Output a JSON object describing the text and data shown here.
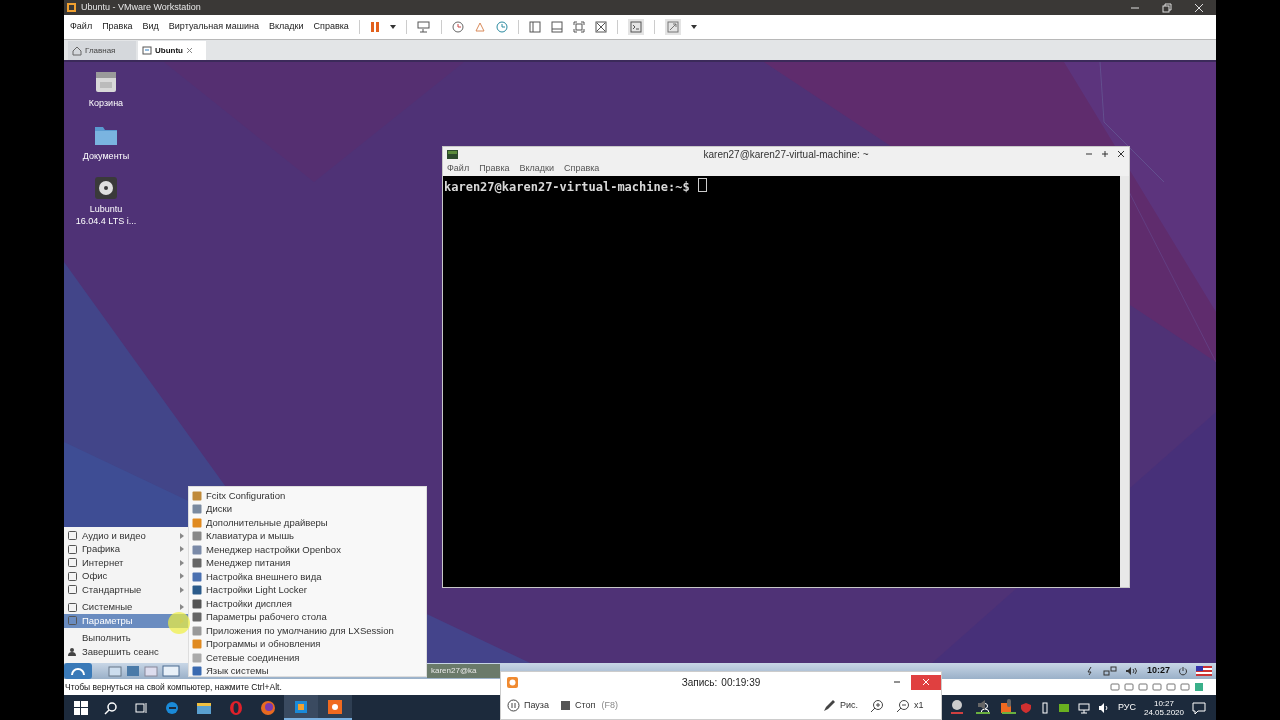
{
  "window": {
    "title": "Ubuntu - VMware Workstation"
  },
  "menu_bar": [
    "Файл",
    "Правка",
    "Вид",
    "Виртуальная машина",
    "Вкладки",
    "Справка"
  ],
  "tabs": [
    {
      "label": "Главная",
      "selected": false
    },
    {
      "label": "Ubuntu",
      "selected": true
    }
  ],
  "desktop_icons": [
    {
      "kind": "trash",
      "lines": [
        "Корзина"
      ]
    },
    {
      "kind": "folder",
      "lines": [
        "Документы"
      ]
    },
    {
      "kind": "disc",
      "lines": [
        "Lubuntu",
        "16.04.4 LTS i..."
      ]
    }
  ],
  "terminal": {
    "title": "karen27@karen27-virtual-machine: ~",
    "menu": [
      "Файл",
      "Правка",
      "Вкладки",
      "Справка"
    ],
    "prompt": "karen27@karen27-virtual-machine:~$"
  },
  "start_menu": {
    "items": [
      {
        "label": "Аудио и видео",
        "kind": "submenu",
        "selected": false
      },
      {
        "label": "Графика",
        "kind": "submenu",
        "selected": false
      },
      {
        "label": "Интернет",
        "kind": "submenu",
        "selected": false
      },
      {
        "label": "Офис",
        "kind": "submenu",
        "selected": false
      },
      {
        "label": "Стандартные",
        "kind": "submenu",
        "selected": false
      },
      {
        "label": "Системные",
        "kind": "submenu",
        "selected": false
      },
      {
        "label": "Параметры",
        "kind": "submenu",
        "selected": true
      },
      {
        "label": "Выполнить",
        "kind": "action",
        "selected": false
      },
      {
        "label": "Завершить сеанс",
        "kind": "logout",
        "selected": false
      }
    ]
  },
  "submenu": {
    "items": [
      "Fcitx Configuration",
      "Диски",
      "Дополнительные драйверы",
      "Клавиатура и мышь",
      "Менеджер настройки Openbox",
      "Менеджер питания",
      "Настройка внешнего вида",
      "Настройки Light Locker",
      "Настройки дисплея",
      "Параметры рабочего стола",
      "Приложения по умолчанию для LXSession",
      "Программы и обновления",
      "Сетевые соединения",
      "Язык системы"
    ]
  },
  "guest_panel": {
    "task": "karen27@ka",
    "clock": "10:27"
  },
  "status_bar": {
    "hint": "Чтобы вернуться на свой компьютер, нажмите Ctrl+Alt."
  },
  "recorder": {
    "title": "Запись:",
    "time": "00:19:39",
    "buttons": [
      {
        "kind": "pause",
        "label": "Пауза"
      },
      {
        "kind": "stop",
        "label": "Стоп",
        "hint": "(F8)"
      },
      {
        "kind": "draw",
        "label": "Рис."
      }
    ],
    "zoom": "x1"
  },
  "taskbar": {
    "language": "РУС",
    "time": "10:27",
    "date": "24.05.2020"
  }
}
